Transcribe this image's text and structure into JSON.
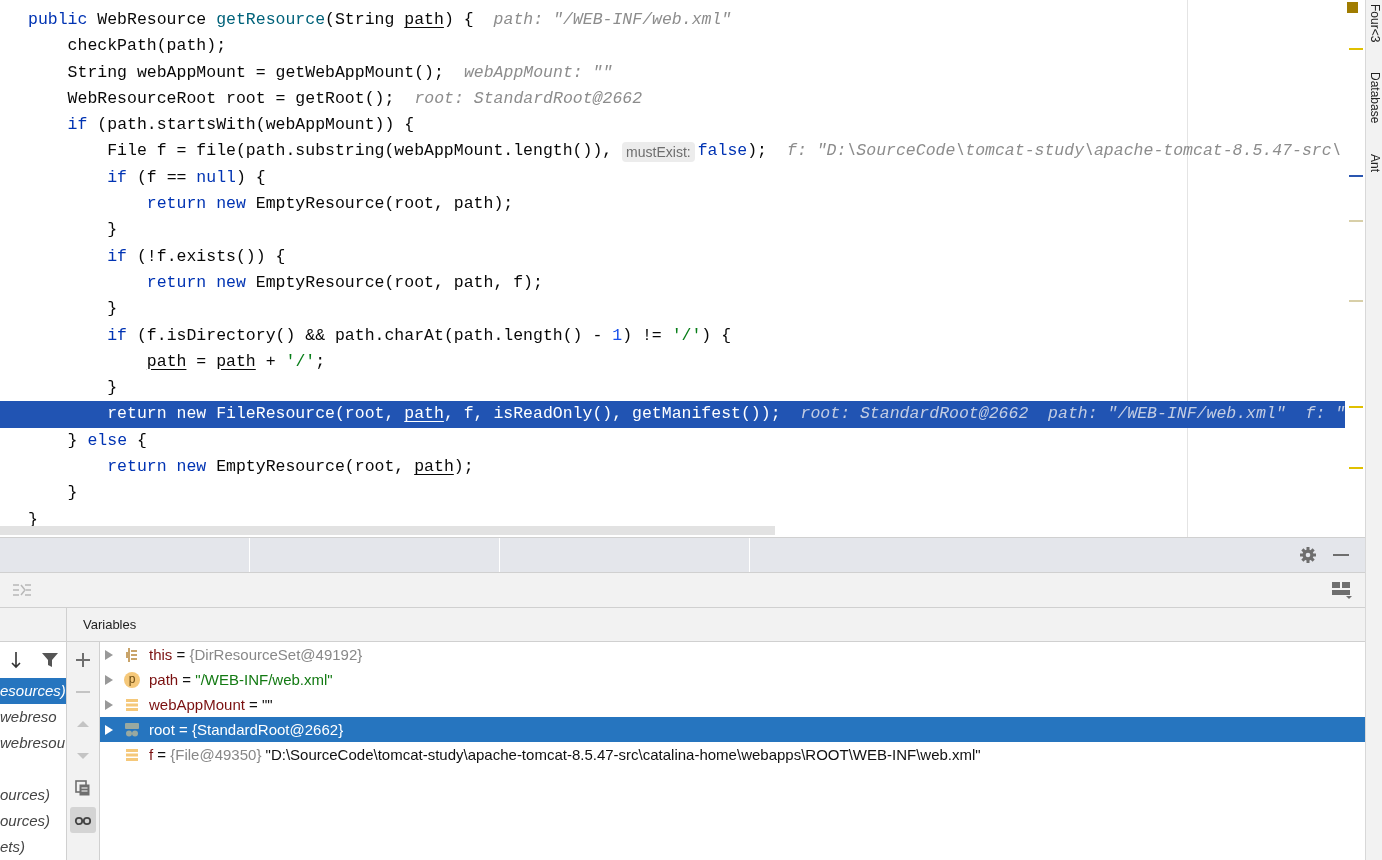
{
  "editor": {
    "lines": [
      {
        "selected": false,
        "parts": [
          {
            "kind": "code",
            "tokens": [
              {
                "text": "public ",
                "kind": "kw"
              },
              {
                "text": "WebResource ",
                "kind": "plain"
              },
              {
                "text": "getResource",
                "kind": "decl"
              },
              {
                "text": "(String ",
                "kind": "plain"
              },
              {
                "text": "path",
                "kind": "ref"
              },
              {
                "text": ") {",
                "kind": "plain"
              }
            ]
          },
          {
            "kind": "hint",
            "text": "path: \"/WEB-INF/web.xml\""
          }
        ]
      },
      {
        "selected": false,
        "parts": [
          {
            "kind": "code",
            "tokens": [
              {
                "text": "    checkPath(path);",
                "kind": "plain"
              }
            ]
          }
        ]
      },
      {
        "selected": false,
        "parts": [
          {
            "kind": "code",
            "tokens": [
              {
                "text": "    String webAppMount = getWebAppMount();",
                "kind": "plain"
              }
            ]
          },
          {
            "kind": "hint",
            "text": "webAppMount: \"\""
          }
        ]
      },
      {
        "selected": false,
        "parts": [
          {
            "kind": "code",
            "tokens": [
              {
                "text": "    WebResourceRoot root = getRoot();",
                "kind": "plain"
              }
            ]
          },
          {
            "kind": "hint",
            "text": "root: StandardRoot@2662"
          }
        ]
      },
      {
        "selected": false,
        "parts": [
          {
            "kind": "code",
            "tokens": [
              {
                "text": "    if",
                "kind": "kw"
              },
              {
                "text": " (path.startsWith(webAppMount)) {",
                "kind": "plain"
              }
            ]
          }
        ]
      },
      {
        "selected": false,
        "parts": [
          {
            "kind": "code",
            "tokens": [
              {
                "text": "        File f = file(path.substring(webAppMount.length()), ",
                "kind": "plain"
              }
            ]
          },
          {
            "kind": "inlay",
            "text": "mustExist:"
          },
          {
            "kind": "code",
            "tokens": [
              {
                "text": "false",
                "kind": "kw"
              },
              {
                "text": ");",
                "kind": "plain"
              }
            ]
          },
          {
            "kind": "hint",
            "text": "f: \"D:\\SourceCode\\tomcat-study\\apache-tomcat-8.5.47-src\\"
          }
        ]
      },
      {
        "selected": false,
        "parts": [
          {
            "kind": "code",
            "tokens": [
              {
                "text": "        if",
                "kind": "kw"
              },
              {
                "text": " (f == ",
                "kind": "plain"
              },
              {
                "text": "null",
                "kind": "kw"
              },
              {
                "text": ") {",
                "kind": "plain"
              }
            ]
          }
        ]
      },
      {
        "selected": false,
        "parts": [
          {
            "kind": "code",
            "tokens": [
              {
                "text": "            return new ",
                "kind": "kw"
              },
              {
                "text": "EmptyResource(root, path);",
                "kind": "plain"
              }
            ]
          }
        ]
      },
      {
        "selected": false,
        "parts": [
          {
            "kind": "code",
            "tokens": [
              {
                "text": "        }",
                "kind": "plain"
              }
            ]
          }
        ]
      },
      {
        "selected": false,
        "parts": [
          {
            "kind": "code",
            "tokens": [
              {
                "text": "        if",
                "kind": "kw"
              },
              {
                "text": " (!f.exists()) {",
                "kind": "plain"
              }
            ]
          }
        ]
      },
      {
        "selected": false,
        "parts": [
          {
            "kind": "code",
            "tokens": [
              {
                "text": "            return new ",
                "kind": "kw"
              },
              {
                "text": "EmptyResource(root, path, f);",
                "kind": "plain"
              }
            ]
          }
        ]
      },
      {
        "selected": false,
        "parts": [
          {
            "kind": "code",
            "tokens": [
              {
                "text": "        }",
                "kind": "plain"
              }
            ]
          }
        ]
      },
      {
        "selected": false,
        "parts": [
          {
            "kind": "code",
            "tokens": [
              {
                "text": "        if",
                "kind": "kw"
              },
              {
                "text": " (f.isDirectory() && path.charAt(path.length() - ",
                "kind": "plain"
              },
              {
                "text": "1",
                "kind": "num"
              },
              {
                "text": ") != ",
                "kind": "plain"
              },
              {
                "text": "'/'",
                "kind": "str"
              },
              {
                "text": ") {",
                "kind": "plain"
              }
            ]
          }
        ]
      },
      {
        "selected": false,
        "parts": [
          {
            "kind": "code",
            "tokens": [
              {
                "text": "            path",
                "kind": "ref"
              },
              {
                "text": " = ",
                "kind": "plain"
              },
              {
                "text": "path",
                "kind": "ref"
              },
              {
                "text": " + ",
                "kind": "plain"
              },
              {
                "text": "'/'",
                "kind": "str"
              },
              {
                "text": ";",
                "kind": "plain"
              }
            ]
          }
        ]
      },
      {
        "selected": false,
        "parts": [
          {
            "kind": "code",
            "tokens": [
              {
                "text": "        }",
                "kind": "plain"
              }
            ]
          }
        ]
      },
      {
        "selected": true,
        "parts": [
          {
            "kind": "code",
            "tokens": [
              {
                "text": "        return new ",
                "kind": "kw"
              },
              {
                "text": "FileResource(root, ",
                "kind": "plain"
              },
              {
                "text": "path",
                "kind": "ref"
              },
              {
                "text": ", f, isReadOnly(), getManifest());",
                "kind": "plain"
              }
            ]
          },
          {
            "kind": "hint",
            "text": "root: StandardRoot@2662  path: \"/WEB-INF/web.xml\"  f: \""
          }
        ]
      },
      {
        "selected": false,
        "parts": [
          {
            "kind": "code",
            "tokens": [
              {
                "text": "    } ",
                "kind": "plain"
              },
              {
                "text": "else",
                "kind": "kw"
              },
              {
                "text": " {",
                "kind": "plain"
              }
            ]
          }
        ]
      },
      {
        "selected": false,
        "parts": [
          {
            "kind": "code",
            "tokens": [
              {
                "text": "        return new ",
                "kind": "kw"
              },
              {
                "text": "EmptyResource(root, ",
                "kind": "plain"
              },
              {
                "text": "path",
                "kind": "ref"
              },
              {
                "text": ");",
                "kind": "plain"
              }
            ]
          }
        ]
      },
      {
        "selected": false,
        "parts": [
          {
            "kind": "code",
            "tokens": [
              {
                "text": "    }",
                "kind": "plain"
              }
            ]
          }
        ]
      },
      {
        "selected": false,
        "parts": [
          {
            "kind": "code",
            "tokens": [
              {
                "text": "}",
                "kind": "plain"
              }
            ]
          }
        ]
      }
    ]
  },
  "tool_strip": [
    "Four<3",
    "Database",
    "Ant"
  ],
  "debugger": {
    "frames": [
      {
        "label": "esources)",
        "selected": true
      },
      {
        "label": "webreso",
        "selected": false
      },
      {
        "label": "webresou",
        "selected": false
      },
      {
        "label": "ources)",
        "selected": false
      },
      {
        "label": "ources)",
        "selected": false
      },
      {
        "label": "ets)",
        "selected": false
      }
    ],
    "variables_title": "Variables",
    "gutter_buttons": [
      {
        "kind": "add",
        "disabled": false,
        "selected": false
      },
      {
        "kind": "remove",
        "disabled": true,
        "selected": false
      },
      {
        "kind": "up",
        "disabled": true,
        "selected": false
      },
      {
        "kind": "down",
        "disabled": true,
        "selected": false
      },
      {
        "kind": "copy",
        "disabled": false,
        "selected": false
      },
      {
        "kind": "watches",
        "disabled": false,
        "selected": true
      }
    ],
    "variables": [
      {
        "kind": "this",
        "expandable": true,
        "selected": false,
        "parts": [
          {
            "text": "this",
            "kind": "name"
          },
          {
            "text": " = ",
            "kind": "plain"
          },
          {
            "text": "{DirResourceSet@49192}",
            "kind": "ref"
          }
        ]
      },
      {
        "kind": "param",
        "icon_letter": "p",
        "expandable": true,
        "selected": false,
        "parts": [
          {
            "text": "path",
            "kind": "name"
          },
          {
            "text": " = ",
            "kind": "plain"
          },
          {
            "text": "\"/WEB-INF/web.xml\"",
            "kind": "str"
          }
        ]
      },
      {
        "kind": "local",
        "expandable": true,
        "selected": false,
        "parts": [
          {
            "text": "webAppMount",
            "kind": "name"
          },
          {
            "text": " = \"\"",
            "kind": "plain"
          }
        ]
      },
      {
        "kind": "object",
        "expandable": true,
        "selected": true,
        "parts": [
          {
            "text": "root",
            "kind": "name"
          },
          {
            "text": " = ",
            "kind": "plain"
          },
          {
            "text": "{StandardRoot@2662}",
            "kind": "ref"
          }
        ]
      },
      {
        "kind": "local",
        "expandable": false,
        "selected": false,
        "parts": [
          {
            "text": "f",
            "kind": "name"
          },
          {
            "text": " = ",
            "kind": "plain"
          },
          {
            "text": "{File@49350}",
            "kind": "ref"
          },
          {
            "text": " \"D:\\SourceCode\\tomcat-study\\apache-tomcat-8.5.47-src\\catalina-home\\webapps\\ROOT\\WEB-INF\\web.xml\"",
            "kind": "plain"
          }
        ]
      }
    ]
  }
}
